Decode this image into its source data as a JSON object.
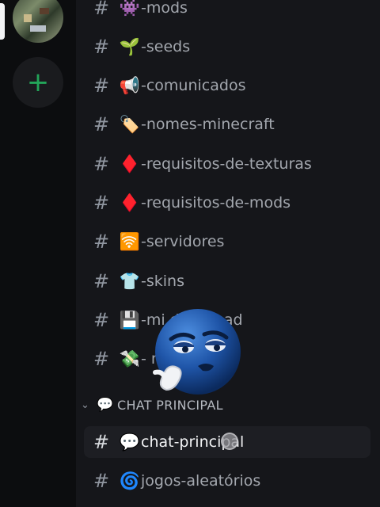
{
  "server_rail": {
    "add_server_label": "+"
  },
  "channels": [
    {
      "emoji": "👾",
      "name": "-mods"
    },
    {
      "emoji": "🌱",
      "name": "-seeds"
    },
    {
      "emoji": "📢",
      "name": "-comunicados"
    },
    {
      "emoji": "🏷️",
      "name": "-nomes-minecraft"
    },
    {
      "emoji": "♦️",
      "name": "-requisitos-de-texturas"
    },
    {
      "emoji": "♦️",
      "name": "-requisitos-de-mods"
    },
    {
      "emoji": "🛜",
      "name": "-servidores"
    },
    {
      "emoji": "👕",
      "name": "-skins"
    },
    {
      "emoji": "💾",
      "name": "-mi      download"
    },
    {
      "emoji": "💸",
      "name": "-      m"
    }
  ],
  "category": {
    "emoji": "💬",
    "label": "CHAT PRINCIPAL"
  },
  "chat_channels": [
    {
      "emoji": "💬",
      "name": "chat-principal"
    },
    {
      "emoji": "🌀",
      "name": "jogos-aleatórios"
    }
  ],
  "colors": {
    "background": "#111214",
    "panel": "#15161a",
    "rail": "#0c0d0f",
    "add_server_green": "#23a559",
    "active_row": "#1d1e23"
  },
  "icons": {
    "channel": "hash-icon",
    "category_toggle": "chevron-down-icon",
    "add_server": "plus-icon"
  }
}
